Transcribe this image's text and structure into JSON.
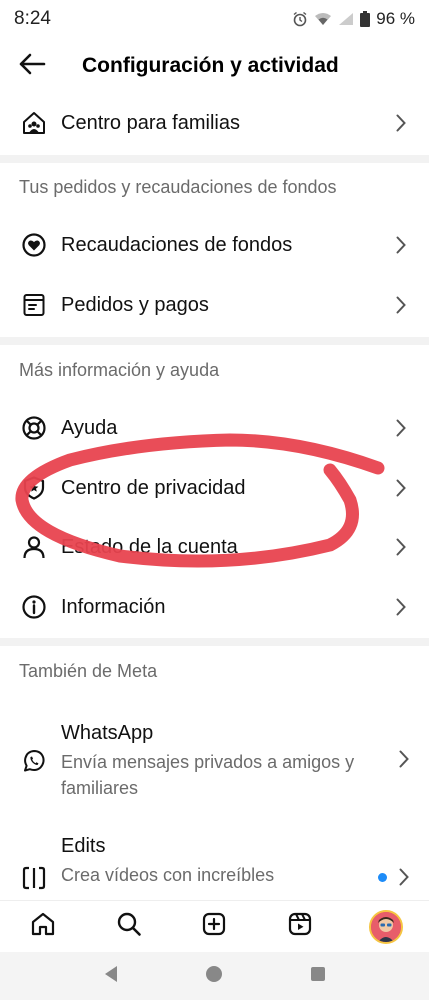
{
  "status": {
    "time": "8:24",
    "battery": "96 %"
  },
  "header": {
    "title": "Configuración y actividad"
  },
  "rows": {
    "family_center": "Centro para familias",
    "fundraisers": "Recaudaciones de fondos",
    "orders_payments": "Pedidos y pagos",
    "help": "Ayuda",
    "privacy_center": "Centro de privacidad",
    "account_status": "Estado de la cuenta",
    "about": "Información"
  },
  "sections": {
    "orders_fundraisers": "Tus pedidos y recaudaciones de fondos",
    "more_info": "Más información y ayuda",
    "also_from_meta": "También de Meta"
  },
  "meta_apps": {
    "whatsapp": {
      "title": "WhatsApp",
      "description": "Envía mensajes privados a amigos y familiares"
    },
    "edits": {
      "title": "Edits",
      "description": "Crea vídeos con increíbles"
    }
  },
  "colors": {
    "annotation": "#e8434f",
    "badge_dot": "#1d8cf8",
    "muted_text": "#6b6b6b"
  },
  "icons": {
    "back": "arrow-left-icon",
    "home": "home-icon",
    "search": "search-icon",
    "create": "plus-square-icon",
    "reels": "reels-icon"
  }
}
